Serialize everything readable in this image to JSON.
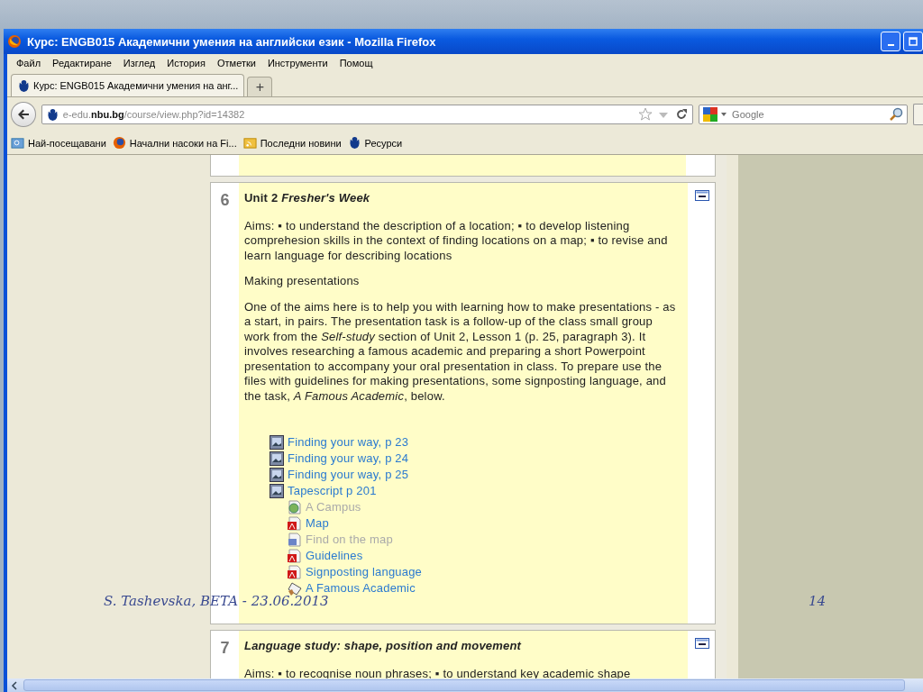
{
  "window": {
    "title": "Курс: ENGB015 Академични умения на английски език - Mozilla Firefox"
  },
  "menu": [
    "Файл",
    "Редактиране",
    "Изглед",
    "История",
    "Отметки",
    "Инструменти",
    "Помощ"
  ],
  "tabs": [
    {
      "label": "Курс: ENGB015 Академични умения на анг...",
      "selected": true
    }
  ],
  "new_tab": "+",
  "address": {
    "url": "e-edu.**nbu.bg**/course/view.php?id=14382"
  },
  "search": {
    "placeholder": "Google"
  },
  "bookmarks": [
    {
      "label": "Най-посещавани",
      "kind": "folder"
    },
    {
      "label": "Начални насоки на Fi...",
      "kind": "firefox"
    },
    {
      "label": "Последни новини",
      "kind": "feed"
    },
    {
      "label": "Ресурси",
      "kind": "site"
    }
  ],
  "sections": [
    {
      "number": "6",
      "title": "Unit 2 *Fresher's Week*",
      "italic": false,
      "paragraphs": [
        "Aims: ▪ to understand the description of a location; ▪ to develop listening comprehesion skills in the context of finding locations on a map; ▪ to revise and learn language for describing locations",
        "Making presentations",
        "One of the aims here is to help you with learning how to make presentations - as a start, in pairs. The presentation task is a follow-up of the class small group work from the *Self-study* section of Unit 2, Lesson 1 (p. 25, paragraph 3). It involves researching a famous academic and preparing a short Powerpoint presentation to accompany your oral presentation in class. To prepare use the files with guidelines for making presentations, some signposting language, and the task, *A Famous Academic*, below."
      ],
      "resources": [
        {
          "label": "Finding your way, p 23",
          "kind": "image",
          "hidden": false
        },
        {
          "label": "Finding your way, p 24",
          "kind": "image",
          "hidden": false
        },
        {
          "label": "Finding your way, p 25",
          "kind": "image",
          "hidden": false
        },
        {
          "label": "Tapescript p 201",
          "kind": "image",
          "hidden": false,
          "children": [
            {
              "label": "A Campus",
              "kind": "web",
              "hidden": true
            },
            {
              "label": "Map",
              "kind": "pdf",
              "hidden": false
            },
            {
              "label": "Find on the map",
              "kind": "doc",
              "hidden": true
            },
            {
              "label": "Guidelines",
              "kind": "pdf",
              "hidden": false
            },
            {
              "label": "Signposting language",
              "kind": "pdf",
              "hidden": false
            },
            {
              "label": "A Famous Academic",
              "kind": "assignment",
              "hidden": false
            }
          ]
        }
      ]
    },
    {
      "number": "7",
      "title": "Language study: shape, position and movement",
      "italic": true,
      "paragraphs": [
        "Aims: ▪ to recognise noun phrases; ▪ to understand key academic shape"
      ]
    }
  ],
  "slide_footer": {
    "author": "S. Tashevska, BETA - 23.06.2013",
    "page": "14"
  }
}
